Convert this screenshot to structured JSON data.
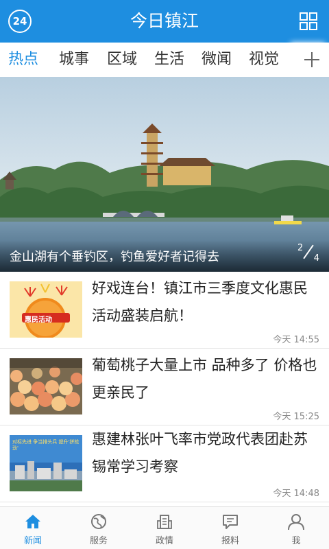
{
  "header": {
    "logo_text": "24",
    "title": "今日镇江",
    "menu_icon": "grid-icon"
  },
  "tabs": [
    {
      "label": "热点",
      "active": true
    },
    {
      "label": "城事",
      "active": false
    },
    {
      "label": "区域",
      "active": false
    },
    {
      "label": "生活",
      "active": false
    },
    {
      "label": "微闻",
      "active": false
    },
    {
      "label": "视觉",
      "active": false
    }
  ],
  "tabs_add_icon": "plus-icon",
  "banner": {
    "caption": "金山湖有个垂钓区，钓鱼爱好者记得去",
    "page_current": "2",
    "page_total": "4"
  },
  "news": [
    {
      "title": "好戏连台！镇江市三季度文化惠民活动盛装启航！",
      "time": "今天 14:55",
      "thumb_text": "惠民活动"
    },
    {
      "title": "葡萄桃子大量上市  品种多了 价格也更亲民了",
      "time": "今天 15:25"
    },
    {
      "title": "惠建林张叶飞率市党政代表团赴苏锡常学习考察",
      "time": "今天 14:48",
      "thumb_text": "对标先进 争当排头兵 提升'拼抢劲'"
    }
  ],
  "bottom_nav": [
    {
      "label": "新闻",
      "icon": "home-icon",
      "active": true
    },
    {
      "label": "服务",
      "icon": "globe-icon",
      "active": false
    },
    {
      "label": "政情",
      "icon": "building-icon",
      "active": false
    },
    {
      "label": "报料",
      "icon": "chat-icon",
      "active": false
    },
    {
      "label": "我",
      "icon": "user-icon",
      "active": false
    }
  ],
  "colors": {
    "accent": "#1e8ee0",
    "text": "#222222",
    "muted": "#888888"
  }
}
